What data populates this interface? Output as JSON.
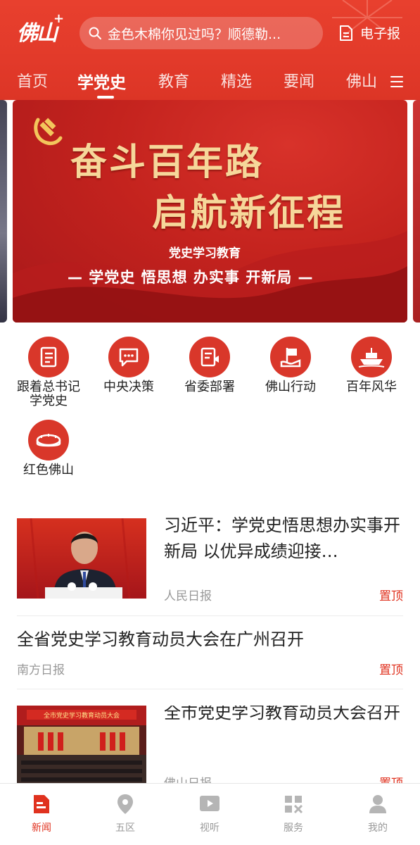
{
  "header": {
    "logo_text": "佛山",
    "logo_plus": "+",
    "search_placeholder": "金色木棉你见过吗？顺德勒...",
    "epaper_label": "电子报",
    "accent_color": "#e23a2a"
  },
  "tabs": [
    {
      "label": "首页"
    },
    {
      "label": "学党史",
      "active": true
    },
    {
      "label": "教育"
    },
    {
      "label": "精选"
    },
    {
      "label": "要闻"
    },
    {
      "label": "佛山"
    }
  ],
  "banner": {
    "line1": "奋斗百年路",
    "line2": "启航新征程",
    "subtitle": "党史学习教育",
    "slogan": "— 学党史  悟思想  办实事  开新局 —"
  },
  "categories": [
    {
      "label": "跟着总书记学党史",
      "icon": "book-list-icon"
    },
    {
      "label": "中央决策",
      "icon": "chat-bubble-icon"
    },
    {
      "label": "省委部署",
      "icon": "document-speaker-icon"
    },
    {
      "label": "佛山行动",
      "icon": "hand-flag-icon"
    },
    {
      "label": "百年风华",
      "icon": "red-boat-icon"
    },
    {
      "label": "红色佛山",
      "icon": "stadium-icon"
    }
  ],
  "news": [
    {
      "title": "习近平：学党史悟思想办实事开新局 以优异成绩迎接…",
      "source": "人民日报",
      "pin": "置顶"
    },
    {
      "title": "全省党史学习教育动员大会在广州召开",
      "source": "南方日报",
      "pin": "置顶"
    },
    {
      "title": "全市党史学习教育动员大会召开",
      "source": "佛山日报",
      "pin": "置顶"
    }
  ],
  "bottom_nav": [
    {
      "label": "新闻",
      "icon": "news-icon",
      "active": true
    },
    {
      "label": "五区",
      "icon": "location-pin-icon"
    },
    {
      "label": "视听",
      "icon": "play-video-icon"
    },
    {
      "label": "服务",
      "icon": "grid-service-icon"
    },
    {
      "label": "我的",
      "icon": "user-icon"
    }
  ]
}
